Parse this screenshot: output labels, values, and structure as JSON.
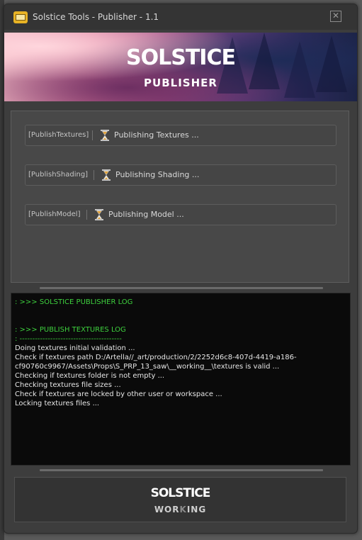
{
  "window": {
    "title": "Solstice Tools - Publisher - 1.1",
    "icon": "publisher-app-icon",
    "close_icon": "close-icon",
    "close_glyph": "✕"
  },
  "banner": {
    "logo_main": "SOLSTICE",
    "logo_sub": "PUBLISHER"
  },
  "tasks": [
    {
      "tag": "[PublishTextures]",
      "status": "Publishing Textures ...",
      "icon": "hourglass-icon"
    },
    {
      "tag": "[PublishShading]",
      "status": "Publishing Shading ...",
      "icon": "hourglass-icon"
    },
    {
      "tag": "[PublishModel]",
      "status": "Publishing Model ...",
      "icon": "hourglass-icon"
    }
  ],
  "log": {
    "lines": [
      {
        "text": ": >>> SOLSTICE PUBLISHER LOG",
        "color": "green"
      },
      {
        "text": "",
        "color": "white"
      },
      {
        "text": ": >>> PUBLISH TEXTURES LOG",
        "color": "green"
      },
      {
        "text": ": ----------------------------------------",
        "color": "green"
      },
      {
        "text": "Doing textures initial validation ...",
        "color": "white"
      },
      {
        "text": "Check if textures path D:/Artella//_art/production/2/2252d6c8-407d-4419-a186-",
        "color": "white"
      },
      {
        "text": "cf90760c9967/Assets\\Props\\S_PRP_13_saw\\__working__\\textures is valid ...",
        "color": "white"
      },
      {
        "text": "Checking if textures folder is not empty ...",
        "color": "white"
      },
      {
        "text": "Checking textures file sizes ...",
        "color": "white"
      },
      {
        "text": "Check if textures are locked by other user or workspace ...",
        "color": "white"
      },
      {
        "text": "Locking textures files ...",
        "color": "white"
      }
    ]
  },
  "footer": {
    "logo_main": "SOLSTICE",
    "logo_sub_a": "WOR",
    "logo_sub_b": "K",
    "logo_sub_c": "ING"
  },
  "colors": {
    "log_green": "#3ed13e",
    "log_white": "#e6e6e6",
    "window_bg": "#3d3d3d",
    "panel_bg": "#484848"
  }
}
